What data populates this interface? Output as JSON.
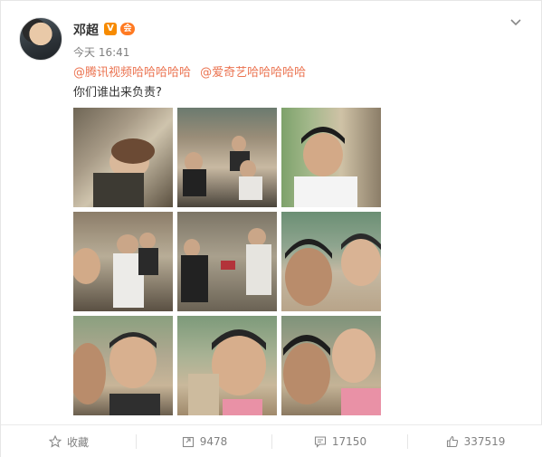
{
  "post": {
    "user_name": "邓超",
    "verified_badge": "V",
    "member_badge": "会",
    "time": "今天 16:41",
    "mentions": [
      "@腾讯视频哈哈哈哈哈",
      "@爱奇艺哈哈哈哈哈"
    ],
    "text": "你们谁出来负责?"
  },
  "footer": {
    "favorite_label": "收藏",
    "repost_count": "9478",
    "comment_count": "17150",
    "like_count": "337519"
  },
  "icons": [
    "chevron-down-icon",
    "star-icon",
    "repost-icon",
    "comment-icon",
    "like-icon"
  ],
  "colors": {
    "mention": "#eb7350",
    "badge": "#f78b00",
    "text": "#333333",
    "muted": "#808080"
  }
}
